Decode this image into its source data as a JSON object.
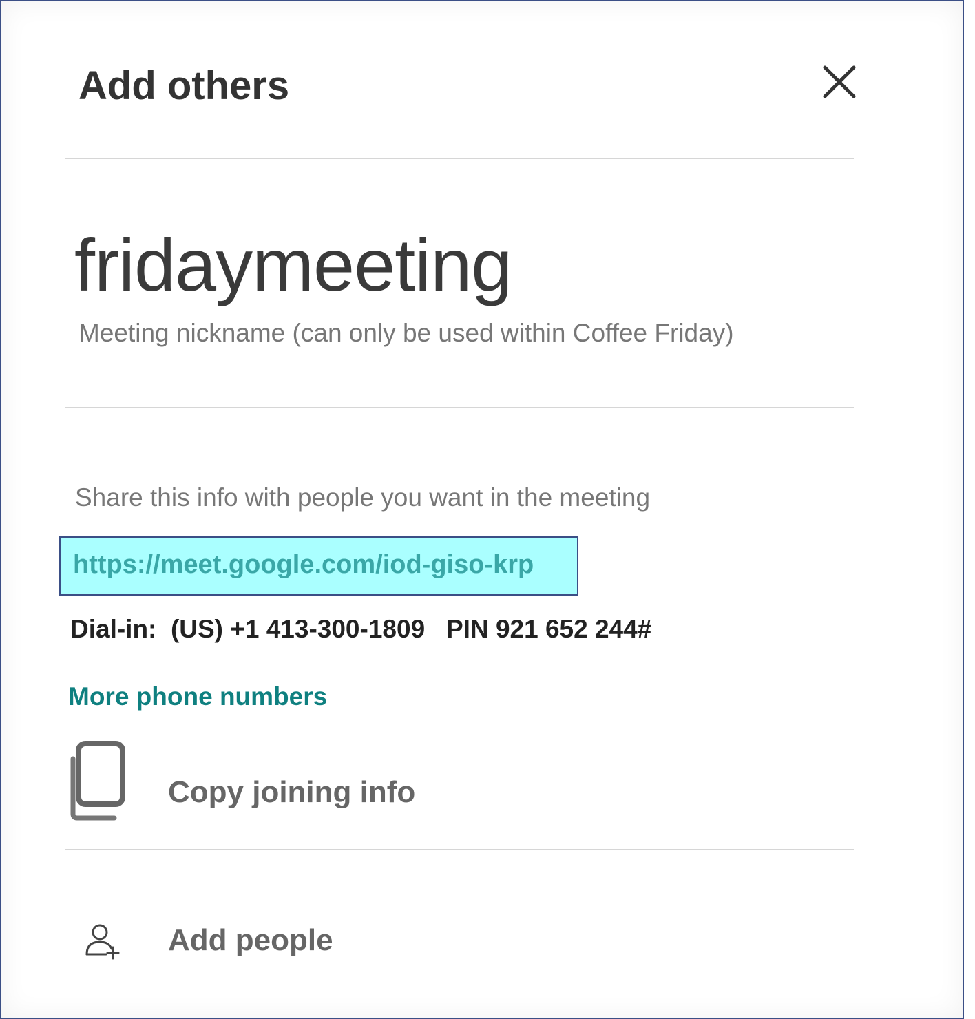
{
  "dialog": {
    "title": "Add others",
    "close_icon": "close-icon"
  },
  "meeting": {
    "nickname": "fridaymeeting",
    "nickname_caption": "Meeting nickname (can only be used within Coffee Friday)"
  },
  "share": {
    "instruction": "Share this info with people you want in the meeting",
    "link": "https://meet.google.com/iod-giso-krp",
    "dialin": "Dial-in:  (US) +1 413-300-1809   PIN 921 652 244#",
    "more_phone_numbers": "More phone numbers"
  },
  "actions": {
    "copy_joining_info": "Copy joining info",
    "copy_icon": "copy-icon",
    "add_people": "Add people",
    "add_people_icon": "add-person-icon"
  },
  "colors": {
    "link_highlight": "#aaffff",
    "link_text": "#3aa7a7",
    "accent": "#0f8080",
    "frame_border": "#3b4f86"
  }
}
